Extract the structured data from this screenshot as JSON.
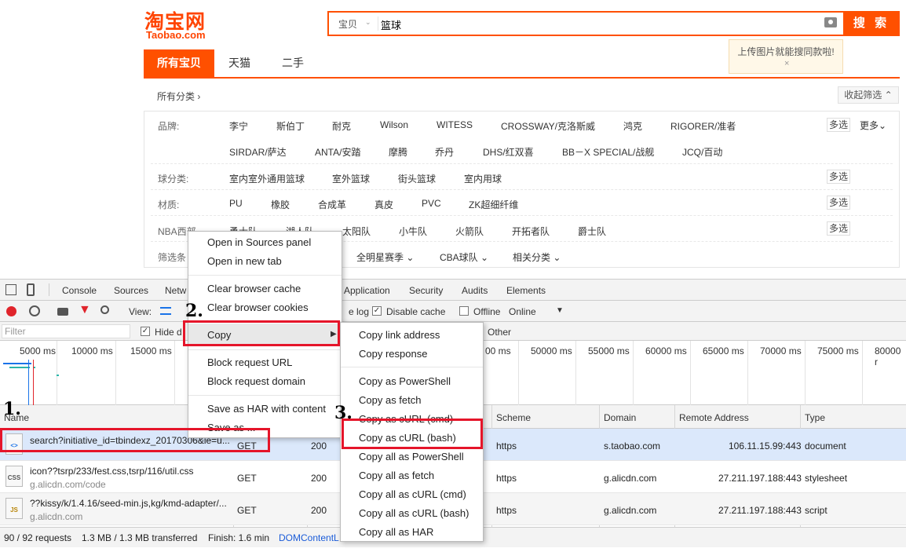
{
  "header": {
    "logo_cn": "淘宝网",
    "logo_en": "Taobao.com",
    "search_scope": "宝贝",
    "search_query": "篮球",
    "search_button": "搜 索",
    "tooltip": "上传图片就能搜同款啦!",
    "tooltip_close": "×"
  },
  "tabs": [
    "所有宝贝",
    "天猫",
    "二手"
  ],
  "all_categories": "所有分类 ›",
  "collapse_button": "收起筛选 ⌃",
  "filters": {
    "brand_label": "品牌:",
    "brand_row1": [
      "李宁",
      "斯伯丁",
      "耐克",
      "Wilson",
      "WITESS",
      "CROSSWAY/克洛斯威",
      "鸿克",
      "RIGORER/准者"
    ],
    "brand_row2": [
      "SIRDAR/萨达",
      "ANTA/安踏",
      "摩腾",
      "乔丹",
      "DHS/红双喜",
      "BB－X SPECIAL/战舰",
      "JCQ/百动"
    ],
    "multi": "多选",
    "more": "更多⌄",
    "ball_label": "球分类:",
    "ball_items": [
      "室内室外通用篮球",
      "室外篮球",
      "街头篮球",
      "室内用球"
    ],
    "material_label": "材质:",
    "material_items": [
      "PU",
      "橡胶",
      "合成革",
      "真皮",
      "PVC",
      "ZK超细纤维"
    ],
    "nba_label": "NBA西部",
    "nba_items": [
      "勇士队",
      "湖人队",
      "太阳队",
      "小牛队",
      "火箭队",
      "开拓者队",
      "爵士队"
    ],
    "filter_label": "筛选条",
    "filter_items": [
      "全明星赛季 ⌄",
      "CBA球队 ⌄",
      "相关分类 ⌄"
    ]
  },
  "devtools": {
    "tabs": [
      "Console",
      "Sources",
      "Netw",
      "Application",
      "Security",
      "Audits",
      "Elements"
    ],
    "view_label": "View:",
    "preserve_log": "e log",
    "disable_cache": "Disable cache",
    "offline": "Offline",
    "online": "Online",
    "filter_placeholder": "Filter",
    "hide_data": "Hide d",
    "other": "Other",
    "ticks_left": [
      "5000 ms",
      "10000 ms",
      "15000 ms"
    ],
    "ticks_right": [
      "00 ms",
      "50000 ms",
      "55000 ms",
      "60000 ms",
      "65000 ms",
      "70000 ms",
      "75000 ms",
      "80000 r"
    ],
    "columns": [
      "Name",
      "Scheme",
      "Domain",
      "Remote Address",
      "Type"
    ],
    "rows": [
      {
        "name": "search?initiative_id=tbindexz_20170306&ie=u...",
        "sub": "",
        "method": "GET",
        "status": "200",
        "scheme": "https",
        "domain": "s.taobao.com",
        "remote": "106.11.15.99:443",
        "type": "document",
        "icon": "<>"
      },
      {
        "name": "icon??tsrp/233/fest.css,tsrp/116/util.css",
        "sub": "g.alicdn.com/code",
        "method": "GET",
        "status": "200",
        "scheme": "https",
        "domain": "g.alicdn.com",
        "remote": "27.211.197.188:443",
        "type": "stylesheet",
        "icon": "CSS"
      },
      {
        "name": "??kissy/k/1.4.16/seed-min.js,kg/kmd-adapter/...",
        "sub": "g.alicdn.com",
        "method": "GET",
        "status": "200",
        "scheme": "https",
        "domain": "g.alicdn.com",
        "remote": "27.211.197.188:443",
        "type": "script",
        "icon": "JS"
      }
    ],
    "status_bar": [
      "90 / 92 requests",
      "1.3 MB / 1.3 MB transferred",
      "Finish: 1.6 min",
      "DOMContentL"
    ]
  },
  "context_menu": {
    "items": [
      "Open in Sources panel",
      "Open in new tab",
      "Clear browser cache",
      "Clear browser cookies",
      "Copy",
      "Block request URL",
      "Block request domain",
      "Save as HAR with content",
      "Save as ..."
    ]
  },
  "copy_submenu": {
    "items": [
      "Copy link address",
      "Copy response",
      "Copy as PowerShell",
      "Copy as fetch",
      "Copy as cURL (cmd)",
      "Copy as cURL (bash)",
      "Copy all as PowerShell",
      "Copy all as fetch",
      "Copy all as cURL (cmd)",
      "Copy all as cURL (bash)",
      "Copy all as HAR"
    ]
  },
  "annotations": [
    "1.",
    "2.",
    "3."
  ],
  "colors": {
    "taobao_orange": "#ff5000",
    "highlight_red": "#e5152a",
    "selected_row": "#dbe8fb"
  }
}
